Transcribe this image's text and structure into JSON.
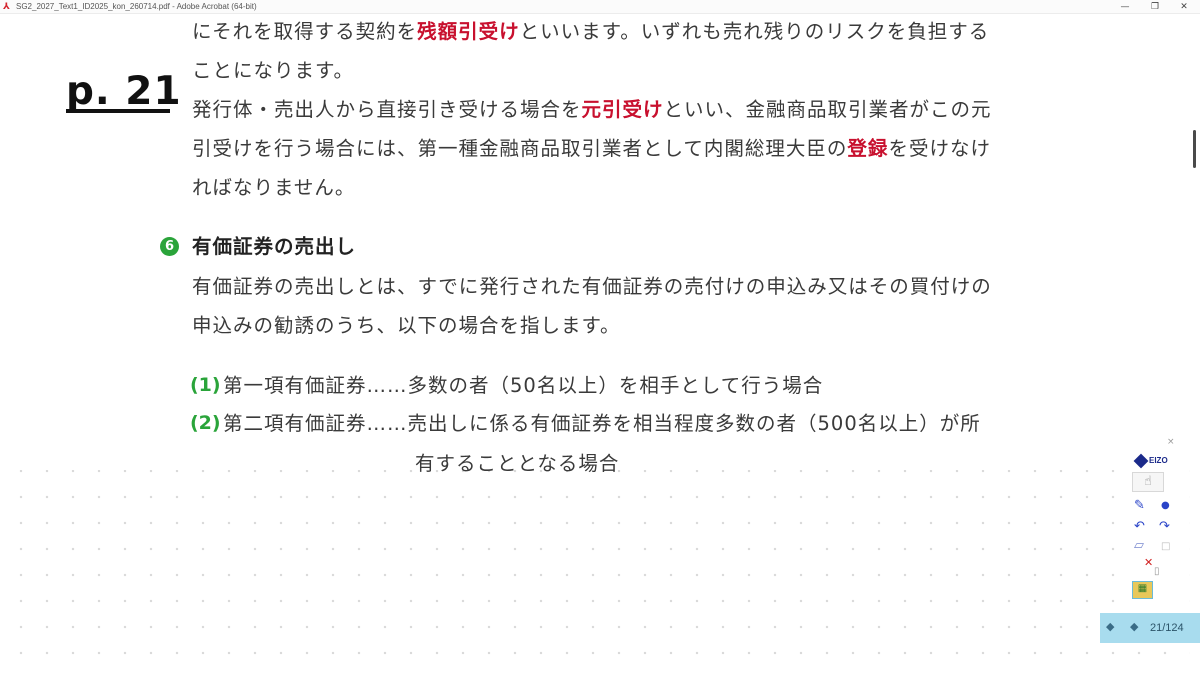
{
  "window": {
    "title": "SG2_2027_Text1_ID2025_kon_260714.pdf - Adobe Acrobat (64-bit)",
    "app_icon": "adobe-acrobat-icon",
    "controls": {
      "minimize": "—",
      "restore": "❐",
      "close": "✕"
    }
  },
  "page_label": "p. 21",
  "paragraphs": [
    {
      "pre": "にそれを取得する契約を",
      "em": "残額引受け",
      "post": "といいます。いずれも売れ残りのリスクを負担する"
    },
    {
      "pre": "ことになります。",
      "em": "",
      "post": ""
    },
    {
      "pre": "発行体・売出人から直接引き受ける場合を",
      "em": "元引受け",
      "post": "といい、金融商品取引業者がこの元"
    },
    {
      "pre": "引受けを行う場合には、第一種金融商品取引業者として内閣総理大臣の",
      "em": "登録",
      "post": "を受けなけ"
    },
    {
      "pre": "ればなりません。",
      "em": "",
      "post": ""
    }
  ],
  "section": {
    "number": "6",
    "heading": "有価証券の売出し",
    "body": [
      "有価証券の売出しとは、すでに発行された有価証券の売付けの申込み又はその買付けの",
      "申込みの勧誘のうち、以下の場合を指します。"
    ],
    "items": [
      {
        "num": "(1)",
        "text": "第一項有価証券……多数の者（50名以上）を相手として行う場合",
        "cont": ""
      },
      {
        "num": "(2)",
        "text": "第二項有価証券……売出しに係る有価証券を相当程度多数の者（500名以上）が所",
        "cont": "有することとなる場合"
      }
    ]
  },
  "palette": {
    "logo": "EIZO",
    "close": "×",
    "tools": [
      "hand-icon",
      "pen-icon",
      "dot-icon",
      "undo-icon",
      "redo-icon",
      "eraser-icon",
      "square-icon",
      "clear-icon",
      "page-icon",
      "screenshot-icon"
    ]
  },
  "navigator": {
    "page_display": "21/124"
  },
  "colors": {
    "emphasis": "#c8102e",
    "section_green": "#2aa43a",
    "nav_bg": "#a8dcee"
  }
}
